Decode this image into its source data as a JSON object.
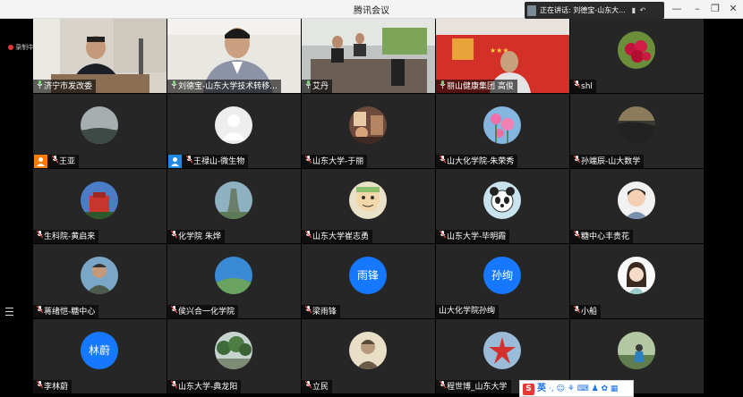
{
  "window": {
    "title": "腾讯会议"
  },
  "speaking_bar": {
    "text": "正在讲话: 刘德宝-山东大..."
  },
  "recording": {
    "label": "录制中"
  },
  "participants": [
    {
      "name": "济宁市发改委",
      "type": "video-office",
      "mic": "on"
    },
    {
      "name": "刘德宝-山东大学技术转移...",
      "type": "video-man",
      "mic": "on"
    },
    {
      "name": "艾丹",
      "type": "video-meeting",
      "mic": "on"
    },
    {
      "name": "丽山健康集团 高俊",
      "type": "video-banner",
      "mic": "on"
    },
    {
      "name": "shl",
      "type": "avatar-fruit",
      "mic": "muted"
    },
    {
      "name": "王亚",
      "type": "avatar-sky",
      "mic": "muted",
      "badge": "orange"
    },
    {
      "name": "王禄山-微生物",
      "type": "avatar-default",
      "mic": "muted",
      "badge": "blue"
    },
    {
      "name": "山东大学-于丽",
      "type": "avatar-room",
      "mic": "muted"
    },
    {
      "name": "山大化学院-朱荣秀",
      "type": "avatar-flower",
      "mic": "muted"
    },
    {
      "name": "孙端辰-山大数学",
      "type": "avatar-sunset",
      "mic": "muted"
    },
    {
      "name": "生科院-黄启来",
      "type": "avatar-building",
      "mic": "muted"
    },
    {
      "name": "化学院 朱烨",
      "type": "avatar-statue",
      "mic": "muted"
    },
    {
      "name": "山东大学崔志勇",
      "type": "avatar-cartoon",
      "mic": "muted"
    },
    {
      "name": "山东大学-毕明霞",
      "type": "avatar-panda",
      "mic": "muted"
    },
    {
      "name": "糖中心丰贵花",
      "type": "avatar-child",
      "mic": "muted"
    },
    {
      "name": "蒋绪恺-糖中心",
      "type": "avatar-man",
      "mic": "muted"
    },
    {
      "name": "侯兴合一化学院",
      "type": "avatar-landscape",
      "mic": "muted"
    },
    {
      "name": "梁雨锋",
      "type": "avatar-text",
      "avatar_text": "雨锋",
      "mic": "muted"
    },
    {
      "name": "山大化学院孙绚",
      "type": "avatar-text",
      "avatar_text": "孙绚",
      "mic": "none"
    },
    {
      "name": "小船",
      "type": "avatar-girl",
      "mic": "muted"
    },
    {
      "name": "李林蔚",
      "type": "avatar-text",
      "avatar_text": "林蔚",
      "mic": "muted"
    },
    {
      "name": "山东大学-典龙阳",
      "type": "avatar-trees",
      "mic": "muted"
    },
    {
      "name": "立民",
      "type": "avatar-portrait",
      "mic": "muted"
    },
    {
      "name": "程世博_山东大学",
      "type": "avatar-starfish",
      "mic": "muted"
    },
    {
      "name": "",
      "type": "avatar-person-green",
      "mic": "none"
    }
  ],
  "ime_toolbar": {
    "logo": "S",
    "mode": "英",
    "icons": "·, ☺ ⚘ ⌨ ♟ ✿ ▦"
  },
  "colors": {
    "bg": "#000000",
    "tile": "#262626",
    "blue_avatar": "#1677ff",
    "badge_orange": "#f57c00",
    "badge_blue": "#1e88e5",
    "ime_red": "#e53935"
  }
}
